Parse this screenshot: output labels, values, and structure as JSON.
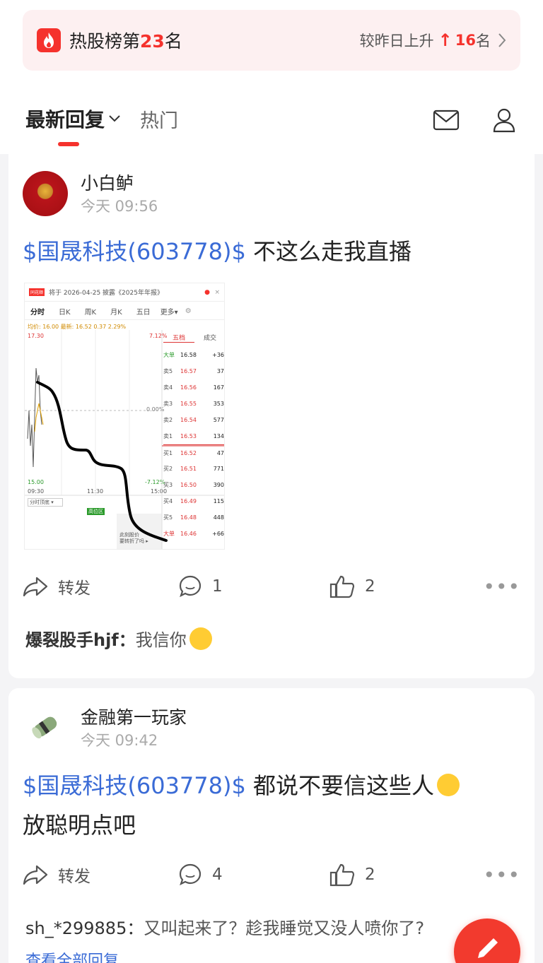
{
  "hot_banner": {
    "title_prefix": "热股榜第",
    "rank": "23",
    "title_suffix": "名",
    "change_prefix": "较昨日上升",
    "change_arrow": "↑",
    "change_value": "16",
    "change_suffix": "名"
  },
  "tabs": {
    "latest": "最新回复",
    "hot": "热门"
  },
  "posts": [
    {
      "user": "小白鲈",
      "time": "今天 09:56",
      "stock": "$国晟科技(603778)$",
      "text": " 不这么走我直播",
      "actions": {
        "forward": "转发",
        "comments": "1",
        "likes": "2"
      },
      "reply": {
        "name": "爆裂股手hjf：",
        "text": "我信你"
      },
      "chart": {
        "header": "将于 2026-04-25 披露《2025年年报》",
        "tabs": [
          "分时",
          "日K",
          "周K",
          "月K",
          "五日",
          "更多▾"
        ],
        "stats": "均价: 16.00  最新: 16.52  0.37  2.29%",
        "high": "17.30",
        "low": "15.00",
        "high_pct": "7.12%",
        "low_pct": "-7.12%",
        "mid_pct": "0.00%",
        "t1": "09:30",
        "t2": "11:30",
        "t3": "15:00",
        "book_tabs": [
          "五档",
          "成交"
        ],
        "book": [
          {
            "label": "大单",
            "price": "16.58",
            "vol": "+36"
          },
          {
            "label": "卖5",
            "price": "16.57",
            "vol": "37"
          },
          {
            "label": "卖4",
            "price": "16.56",
            "vol": "167"
          },
          {
            "label": "卖3",
            "price": "16.55",
            "vol": "353"
          },
          {
            "label": "卖2",
            "price": "16.54",
            "vol": "577"
          },
          {
            "label": "卖1",
            "price": "16.53",
            "vol": "134"
          },
          {
            "label": "买1",
            "price": "16.52",
            "vol": "47"
          },
          {
            "label": "买2",
            "price": "16.51",
            "vol": "771"
          },
          {
            "label": "买3",
            "price": "16.50",
            "vol": "390"
          },
          {
            "label": "买4",
            "price": "16.49",
            "vol": "115"
          },
          {
            "label": "买5",
            "price": "16.48",
            "vol": "448"
          },
          {
            "label": "大单",
            "price": "16.46",
            "vol": "+66"
          }
        ],
        "sub_label": "分时顶底 ▾",
        "tag": "高位区",
        "popup": "此刻股价\n要转折了吗 ▸"
      }
    },
    {
      "user": "金融第一玩家",
      "time": "今天 09:42",
      "stock": "$国晟科技(603778)$",
      "text": " 都说不要信这些人",
      "text2": "放聪明点吧",
      "actions": {
        "forward": "转发",
        "comments": "4",
        "likes": "2"
      },
      "reply": {
        "name": "sh_*299885：",
        "text": "又叫起来了？趁我睡觉又没人喷你了?"
      },
      "view_all": "查看全部回复"
    }
  ],
  "colors": {
    "accent": "#f5322d",
    "link": "#3a6bd6"
  }
}
